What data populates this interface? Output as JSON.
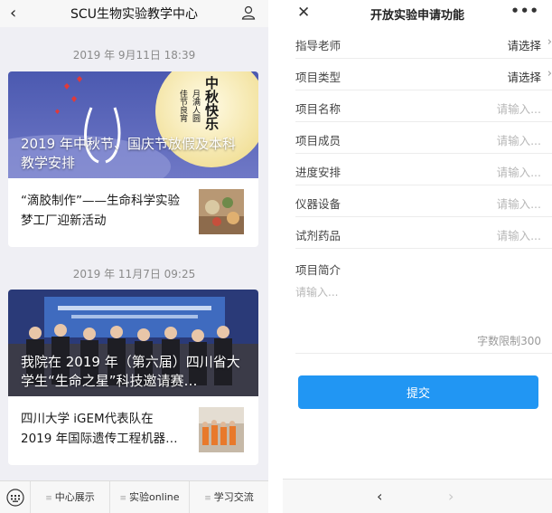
{
  "left": {
    "header": {
      "title": "SCU生物实验教学中心"
    },
    "groups": [
      {
        "timestamp": "2019 年 9月11日 18:39",
        "main_title": "2019 年中秋节、国庆节放假及本科教学安排",
        "banner_calligraphy": [
          "中秋快乐",
          "月满人圆",
          "佳节良宵"
        ],
        "sub_title": "“滴胶制作”——生命科学实验梦工厂迎新活动"
      },
      {
        "timestamp": "2019 年 11月7日 09:25",
        "main_title": "我院在 2019 年（第六届）四川省大学生“生命之星”科技邀请赛…",
        "sub_title": "四川大学 iGEM代表队在2019 年国际遗传工程机器…"
      }
    ],
    "footer": {
      "tabs": [
        {
          "label": "中心展示"
        },
        {
          "label": "实验online"
        },
        {
          "label": "学习交流"
        }
      ]
    }
  },
  "right": {
    "header": {
      "title": "开放实验申请功能"
    },
    "fields": [
      {
        "label": "指导老师",
        "value": "请选择"
      },
      {
        "label": "项目类型",
        "value": "请选择"
      },
      {
        "label": "项目名称",
        "placeholder": "请输入..."
      },
      {
        "label": "项目成员",
        "placeholder": "请输入..."
      },
      {
        "label": "进度安排",
        "placeholder": "请输入..."
      },
      {
        "label": "仪器设备",
        "placeholder": "请输入..."
      },
      {
        "label": "试剂药品",
        "placeholder": "请输入..."
      }
    ],
    "intro": {
      "label": "项目简介",
      "placeholder": "请输入...",
      "limit": "字数限制300"
    },
    "submit_label": "提交"
  },
  "colors": {
    "accent": "#2196f3",
    "bg_left": "#efeff4"
  }
}
